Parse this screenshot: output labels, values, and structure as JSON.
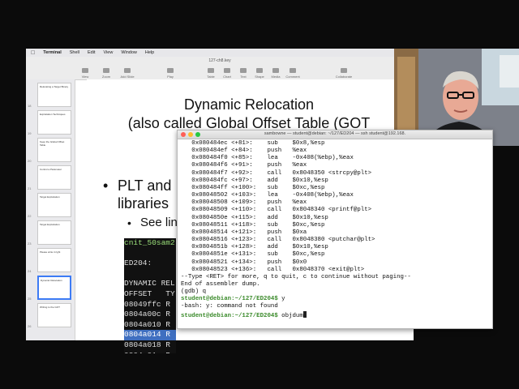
{
  "menubar": {
    "apple": "",
    "items": [
      "Terminal",
      "Shell",
      "Edit",
      "View",
      "Window",
      "Help"
    ]
  },
  "keynote": {
    "file_title": "127-ch8.key",
    "toolbar": [
      "View",
      "Zoom",
      "Add Slide",
      "Play",
      "Table",
      "Chart",
      "Text",
      "Shape",
      "Media",
      "Comment",
      "Collaborate",
      "Format"
    ],
    "thumbs": [
      {
        "num": "18",
        "text": "Relocating a Target Binary"
      },
      {
        "num": "19",
        "text": "Exploitation Techniques"
      },
      {
        "num": "20",
        "text": "Keep the Global Offset Table"
      },
      {
        "num": "21",
        "text": "Control a Parameter"
      },
      {
        "num": "22",
        "text": "Target Exploitation"
      },
      {
        "num": "23",
        "text": "Target Exploitation"
      },
      {
        "num": "24",
        "text": "Please write it right"
      },
      {
        "num": "25",
        "text": "Dynamic Relocation"
      },
      {
        "num": "26",
        "text": "Writing to the GOT"
      }
    ]
  },
  "slide": {
    "title_line1": "Dynamic Relocation",
    "title_line2": "(also called Global Offset Table (GOT",
    "bullet1_line1": "PLT and",
    "bullet1_line2": "libraries",
    "bullet2": "See lin",
    "term_lines": [
      {
        "t": "cnit_50sam2",
        "c": "g"
      },
      {
        "t": "",
        "c": ""
      },
      {
        "t": "ED204:",
        "c": ""
      },
      {
        "t": "",
        "c": ""
      },
      {
        "t": "DYNAMIC REL",
        "c": ""
      },
      {
        "t": "OFFSET   TY",
        "c": ""
      },
      {
        "t": "08049ffc R",
        "c": ""
      },
      {
        "t": "0804a00c R",
        "c": ""
      },
      {
        "t": "0804a010 R",
        "c": ""
      },
      {
        "t": "0804a014 R",
        "c": "hl"
      },
      {
        "t": "0804a018 R",
        "c": ""
      },
      {
        "t": "0804a01c R",
        "c": ""
      }
    ]
  },
  "terminal": {
    "title": "sambowne — student@debian: ~/127/ED204 — ssh student@192.168.",
    "lines": [
      "   0x080484ec <+81>:    sub    $0x8,%esp",
      "   0x080484ef <+84>:    push   %eax",
      "   0x080484f0 <+85>:    lea    -0x408(%ebp),%eax",
      "   0x080484f6 <+91>:    push   %eax",
      "   0x080484f7 <+92>:    call   0x8048350 <strcpy@plt>",
      "   0x080484fc <+97>:    add    $0x10,%esp",
      "   0x080484ff <+100>:   sub    $0xc,%esp",
      "   0x08048502 <+103>:   lea    -0x408(%ebp),%eax",
      "   0x08048508 <+109>:   push   %eax",
      "   0x08048509 <+110>:   call   0x8048340 <printf@plt>",
      "   0x0804850e <+115>:   add    $0x10,%esp",
      "   0x08048511 <+118>:   sub    $0xc,%esp",
      "   0x08048514 <+121>:   push   $0xa",
      "   0x08048516 <+123>:   call   0x8048380 <putchar@plt>",
      "   0x0804851b <+128>:   add    $0x10,%esp",
      "   0x0804851e <+131>:   sub    $0xc,%esp",
      "   0x08048521 <+134>:   push   $0x0",
      "   0x08048523 <+136>:   call   0x8048370 <exit@plt>",
      "--Type <RET> for more, q to quit, c to continue without paging--",
      "End of assembler dump.",
      "(gdb) q"
    ],
    "prompt": "student@debian:~/127/ED204$",
    "cmd1": " y",
    "error": "-bash: y: command not found",
    "cmd2": " objdum"
  }
}
